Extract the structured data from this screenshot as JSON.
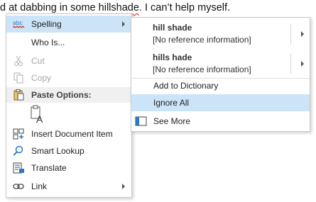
{
  "document": {
    "before": "d at dabbing in some ",
    "misspelled": "hillshade",
    "after": ". I can’t help myself."
  },
  "context_menu": {
    "spelling": {
      "label": "Spelling",
      "icon": "spelling-abc-icon"
    },
    "who_is": {
      "label": "Who Is..."
    },
    "cut": {
      "label": "Cut",
      "icon": "scissors-icon"
    },
    "copy": {
      "label": "Copy",
      "icon": "copy-icon"
    },
    "paste_options": {
      "label": "Paste Options:",
      "icon": "clipboard-icon",
      "keep_text_icon": "paste-keep-text-only-icon"
    },
    "insert_document_item": {
      "label": "Insert Document Item",
      "icon": "insert-document-item-icon"
    },
    "smart_lookup": {
      "label": "Smart Lookup",
      "icon": "search-icon"
    },
    "translate": {
      "label": "Translate",
      "icon": "translate-icon"
    },
    "link": {
      "label": "Link",
      "icon": "link-icon"
    }
  },
  "spelling_submenu": {
    "suggestions": [
      {
        "word": "hill shade",
        "note": "[No reference information]"
      },
      {
        "word": "hills hade",
        "note": "[No reference information]"
      }
    ],
    "add_to_dictionary": {
      "label": "Add to Dictionary"
    },
    "ignore_all": {
      "label": "Ignore All"
    },
    "see_more": {
      "label": "See More",
      "icon": "see-more-icon"
    }
  },
  "colors": {
    "hover": "#cce4f7",
    "squiggle": "#d0201b",
    "disabled_text": "#a6a6a6",
    "icon_blue": "#2b79c2"
  }
}
